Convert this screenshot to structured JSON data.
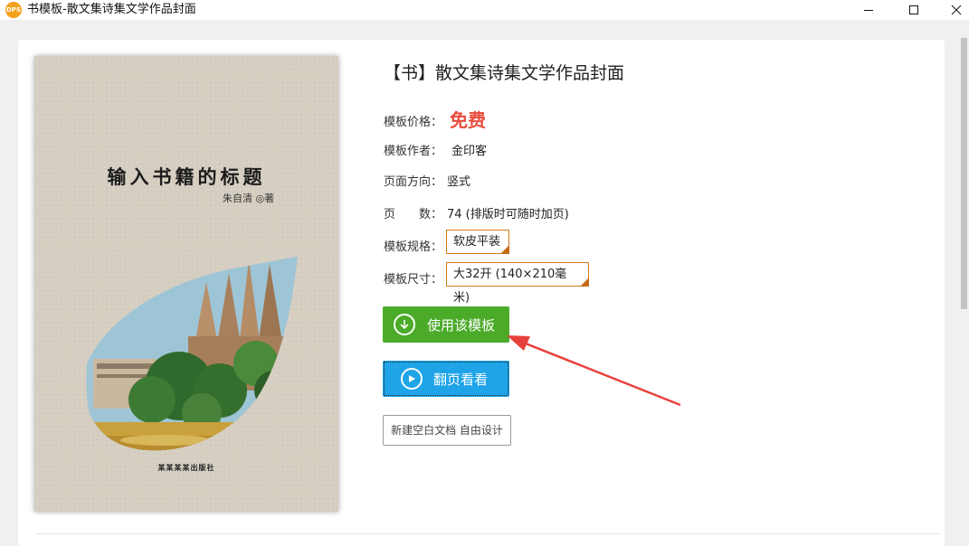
{
  "window": {
    "app_icon_text": "DPS",
    "title": "书模板-散文集诗集文学作品封面",
    "controls": [
      "minimize-icon",
      "maximize-icon",
      "close-icon"
    ]
  },
  "cover": {
    "title": "输入书籍的标题",
    "author": "朱自清 ◎著",
    "publisher": "某某某某出版社"
  },
  "template": {
    "title": "【书】散文集诗集文学作品封面",
    "price_label": "模板价格：",
    "price_value": "免费",
    "author_label": "模板作者：",
    "author_value": "金印客",
    "orientation_label": "页面方向：",
    "orientation_value": "竖式",
    "pages_label": "页　　数：",
    "pages_value": "74 (排版时可随时加页)",
    "spec_label": "模板规格：",
    "spec_value": "软皮平装",
    "size_label": "模板尺寸：",
    "size_value": "大32开 (140×210毫米)"
  },
  "actions": {
    "use_template": "使用该模板",
    "flip_preview": "翻页看看",
    "new_blank": "新建空白文档 自由设计"
  },
  "colors": {
    "price": "#e84c3d",
    "use_button": "#4bab29",
    "preview_button": "#1fa4e8",
    "select_border": "#d07b1a",
    "arrow": "#e8413b"
  }
}
